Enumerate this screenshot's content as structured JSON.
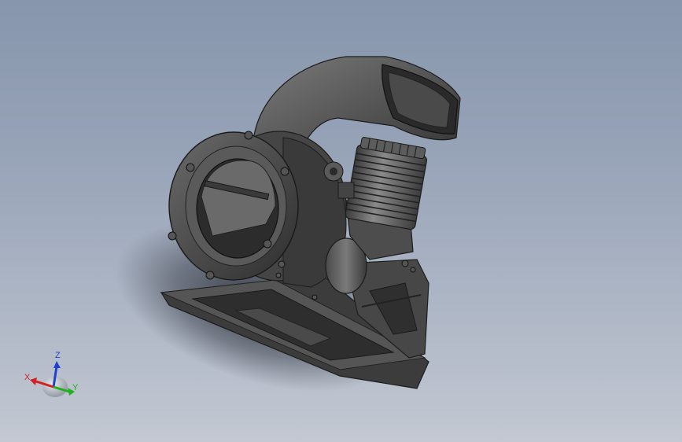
{
  "viewport": {
    "model_name": "engine-blower-assembly",
    "background_top": "#8796ad",
    "background_bottom": "#c3c8d2"
  },
  "triad": {
    "x_label": "X",
    "y_label": "Y",
    "z_label": "Z",
    "x_color": "#d42020",
    "y_color": "#20b020",
    "z_color": "#2040d0"
  }
}
